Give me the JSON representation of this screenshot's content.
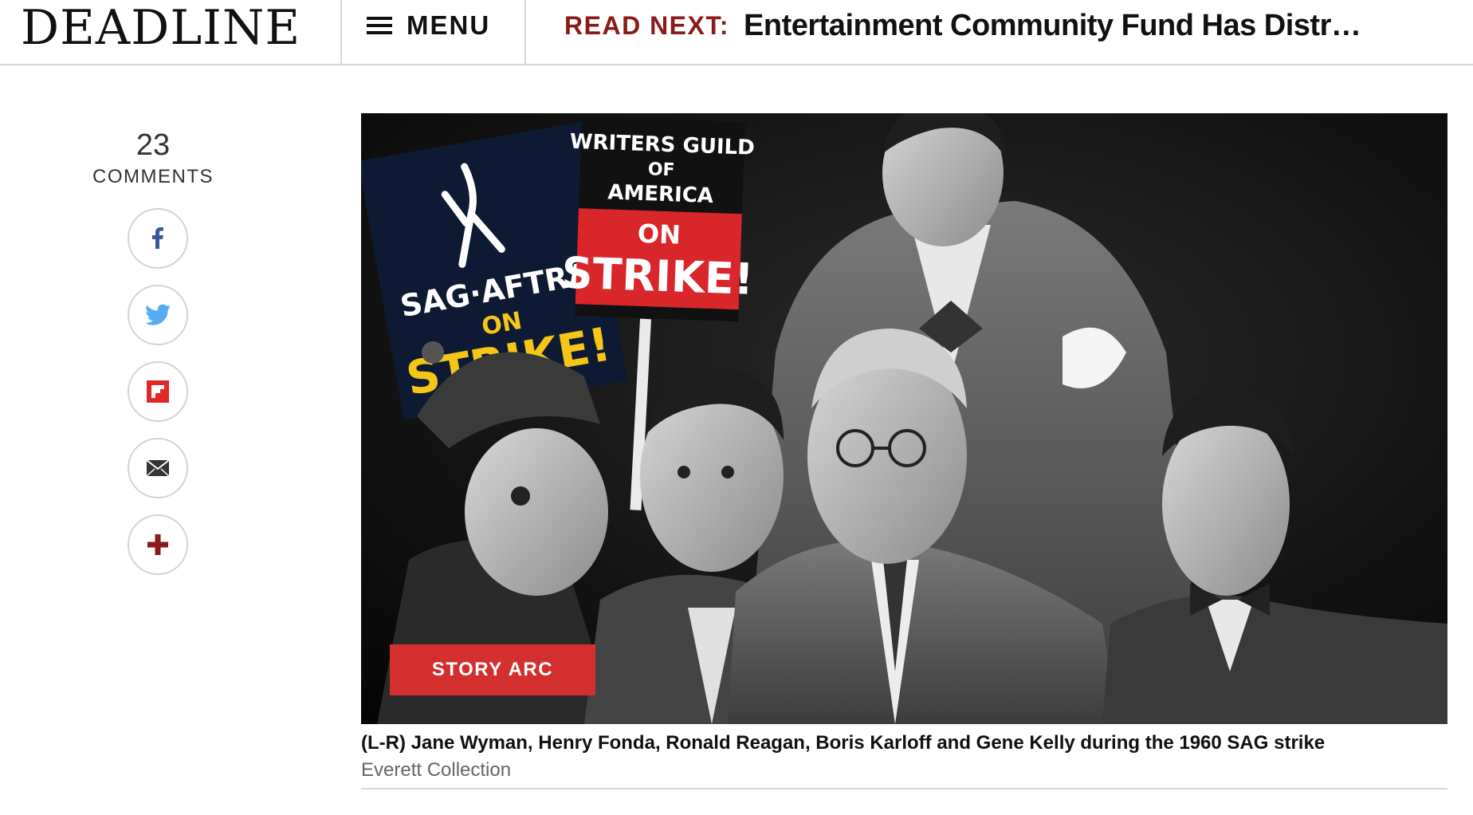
{
  "header": {
    "logo": "DEADLINE",
    "menu_label": "MENU",
    "read_next_label": "READ NEXT:",
    "read_next_title": "Entertainment Community Fund Has Distr…"
  },
  "rail": {
    "comment_count": "23",
    "comment_label": "COMMENTS",
    "share_icons": [
      "facebook-icon",
      "twitter-icon",
      "flipboard-icon",
      "email-icon",
      "plus-icon"
    ]
  },
  "hero": {
    "badge_label": "STORY ARC",
    "sign_sag_line1": "SAG·AFTRA",
    "sign_sag_line2": "ON",
    "sign_sag_line3": "STRIKE!",
    "sign_wga_line1": "WRITERS GUILD",
    "sign_wga_line2": "OF",
    "sign_wga_line3": "AMERICA",
    "sign_wga_line4": "ON",
    "sign_wga_line5": "STRIKE!"
  },
  "caption": {
    "text": "(L-R) Jane Wyman, Henry Fonda, Ronald Reagan, Boris Karloff and Gene Kelly during the 1960 SAG strike",
    "credit": "Everett Collection"
  },
  "colors": {
    "brand_red": "#8b1a1a",
    "badge_red": "#d32f2f",
    "sign_yellow": "#f5c518",
    "sign_navy": "#0e1a33",
    "facebook_blue": "#3b5998",
    "twitter_blue": "#1da1f2",
    "flipboard_red": "#e12828"
  }
}
